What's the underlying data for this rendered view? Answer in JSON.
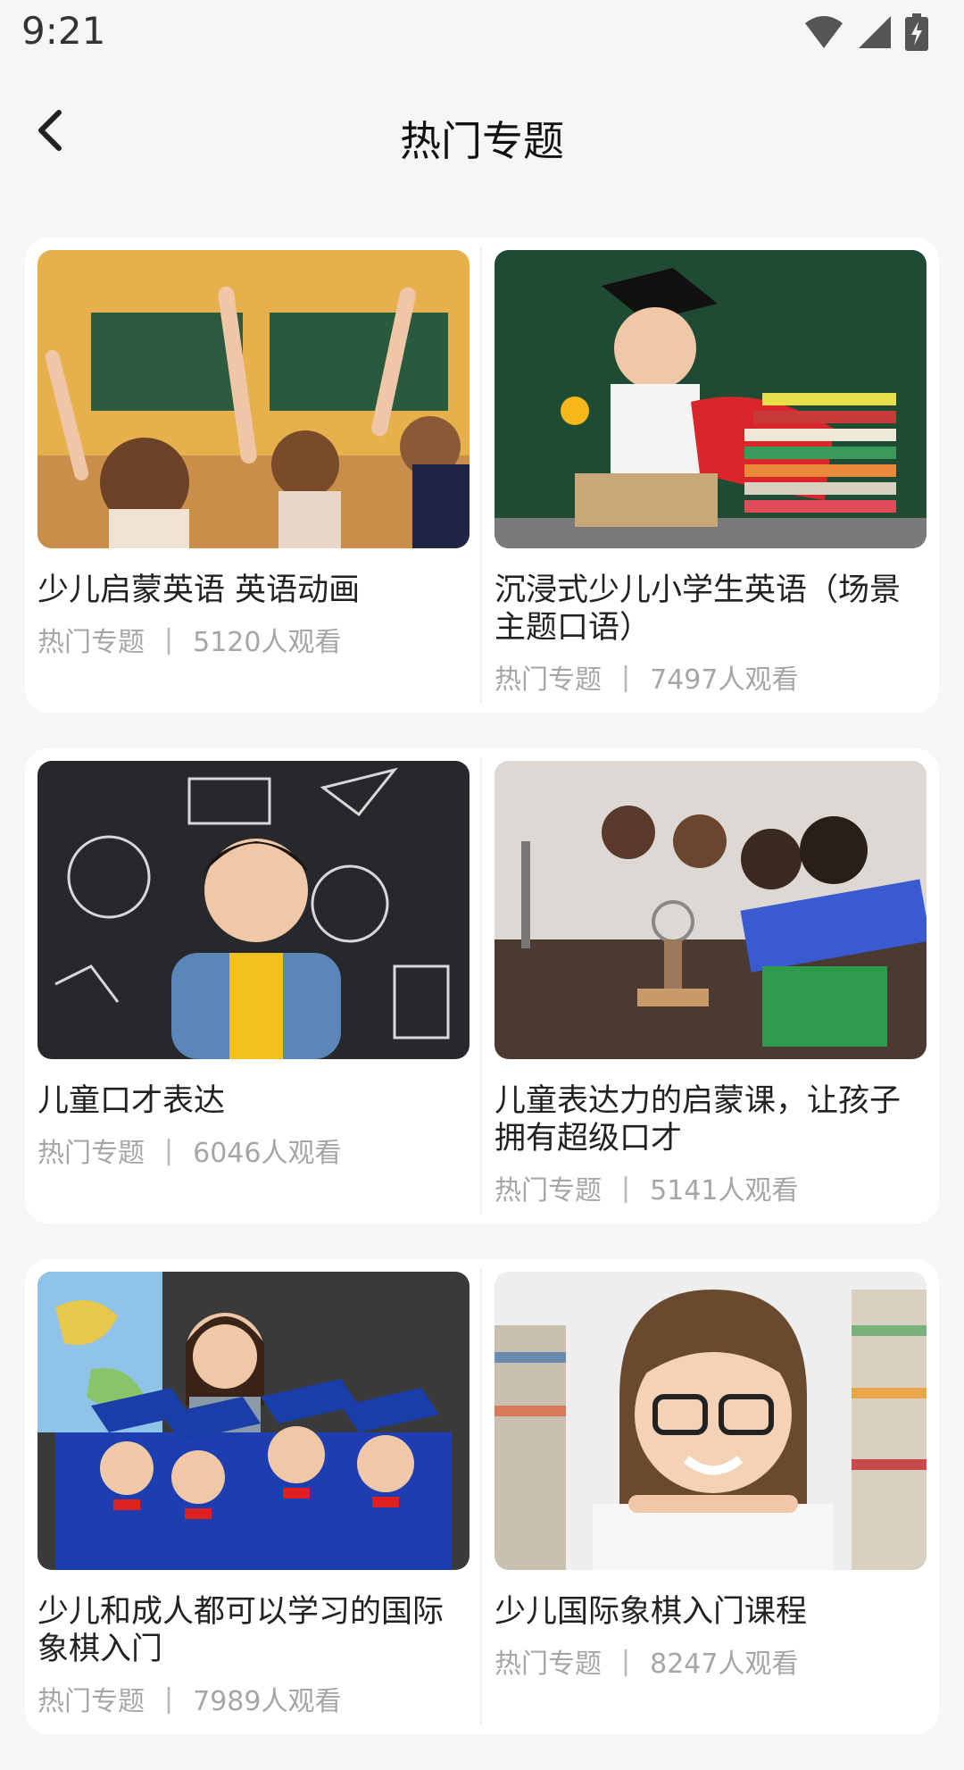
{
  "status": {
    "time": "9:21"
  },
  "header": {
    "title": "热门专题"
  },
  "cards": [
    {
      "title": "少儿启蒙英语 英语动画",
      "category": "热门专题",
      "views": "5120人观看",
      "image": "classroom-raised-hands-photo"
    },
    {
      "title": "沉浸式少儿小学生英语（场景主题口语）",
      "category": "热门专题",
      "views": "7497人观看",
      "image": "graduate-boy-books-photo"
    },
    {
      "title": "儿童口才表达",
      "category": "热门专题",
      "views": "6046人观看",
      "image": "boy-chalkboard-doodles-photo"
    },
    {
      "title": "儿童表达力的启蒙课，让孩子拥有超级口才",
      "category": "热门专题",
      "views": "5141人观看",
      "image": "science-lab-children-photo"
    },
    {
      "title": "少儿和成人都可以学习的国际象棋入门",
      "category": "热门专题",
      "views": "7989人观看",
      "image": "kids-graduation-caps-photo"
    },
    {
      "title": "少儿国际象棋入门课程",
      "category": "热门专题",
      "views": "8247人观看",
      "image": "girl-glasses-books-photo"
    }
  ],
  "separator": "|"
}
